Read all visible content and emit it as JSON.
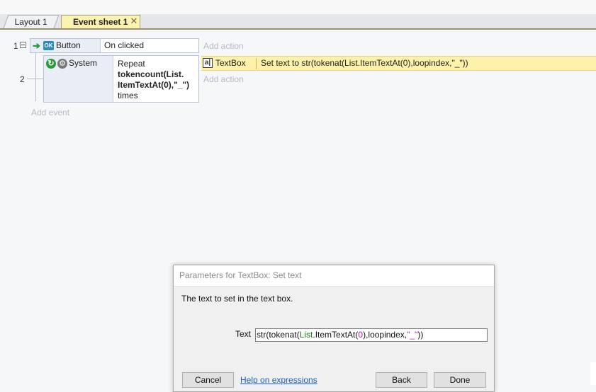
{
  "tabs": [
    {
      "label": "Layout 1",
      "active": false
    },
    {
      "label": "Event sheet 1",
      "active": true,
      "close_glyph": "✕"
    }
  ],
  "event_sheet": {
    "event_numbers": [
      "1",
      "2"
    ],
    "event1": {
      "condition1": {
        "object": "Button",
        "text": "On clicked",
        "icon": "arrow-icon",
        "object_icon": "ok-icon",
        "object_icon_text": "OK"
      },
      "condition2": {
        "object": "System",
        "text_line1": "Repeat",
        "text_bold": "tokencount(List.\nItemTextAt(0),\"_\")",
        "text_line3": "times",
        "icon": "loop-icon",
        "object_icon": "gear-icon"
      },
      "action": {
        "object": "TextBox",
        "text": "Set text to str(tokenat(List.ItemTextAt(0),loopindex,\"_\"))",
        "icon_text": "a|"
      }
    },
    "add_action_label": "Add action",
    "add_event_label": "Add event"
  },
  "dialog": {
    "title": "Parameters for TextBox: Set text",
    "description": "The text to set in the text box.",
    "param_label": "Text",
    "param_value": "str(tokenat(List.ItemTextAt(0),loopindex,\"_\"))",
    "buttons": {
      "cancel": "Cancel",
      "back": "Back",
      "done": "Done"
    },
    "help_link": "Help on expressions"
  },
  "colors": {
    "action_highlight": "#fdf1ac",
    "active_tab": "#fbf3b2",
    "link": "#1a5fc8"
  }
}
